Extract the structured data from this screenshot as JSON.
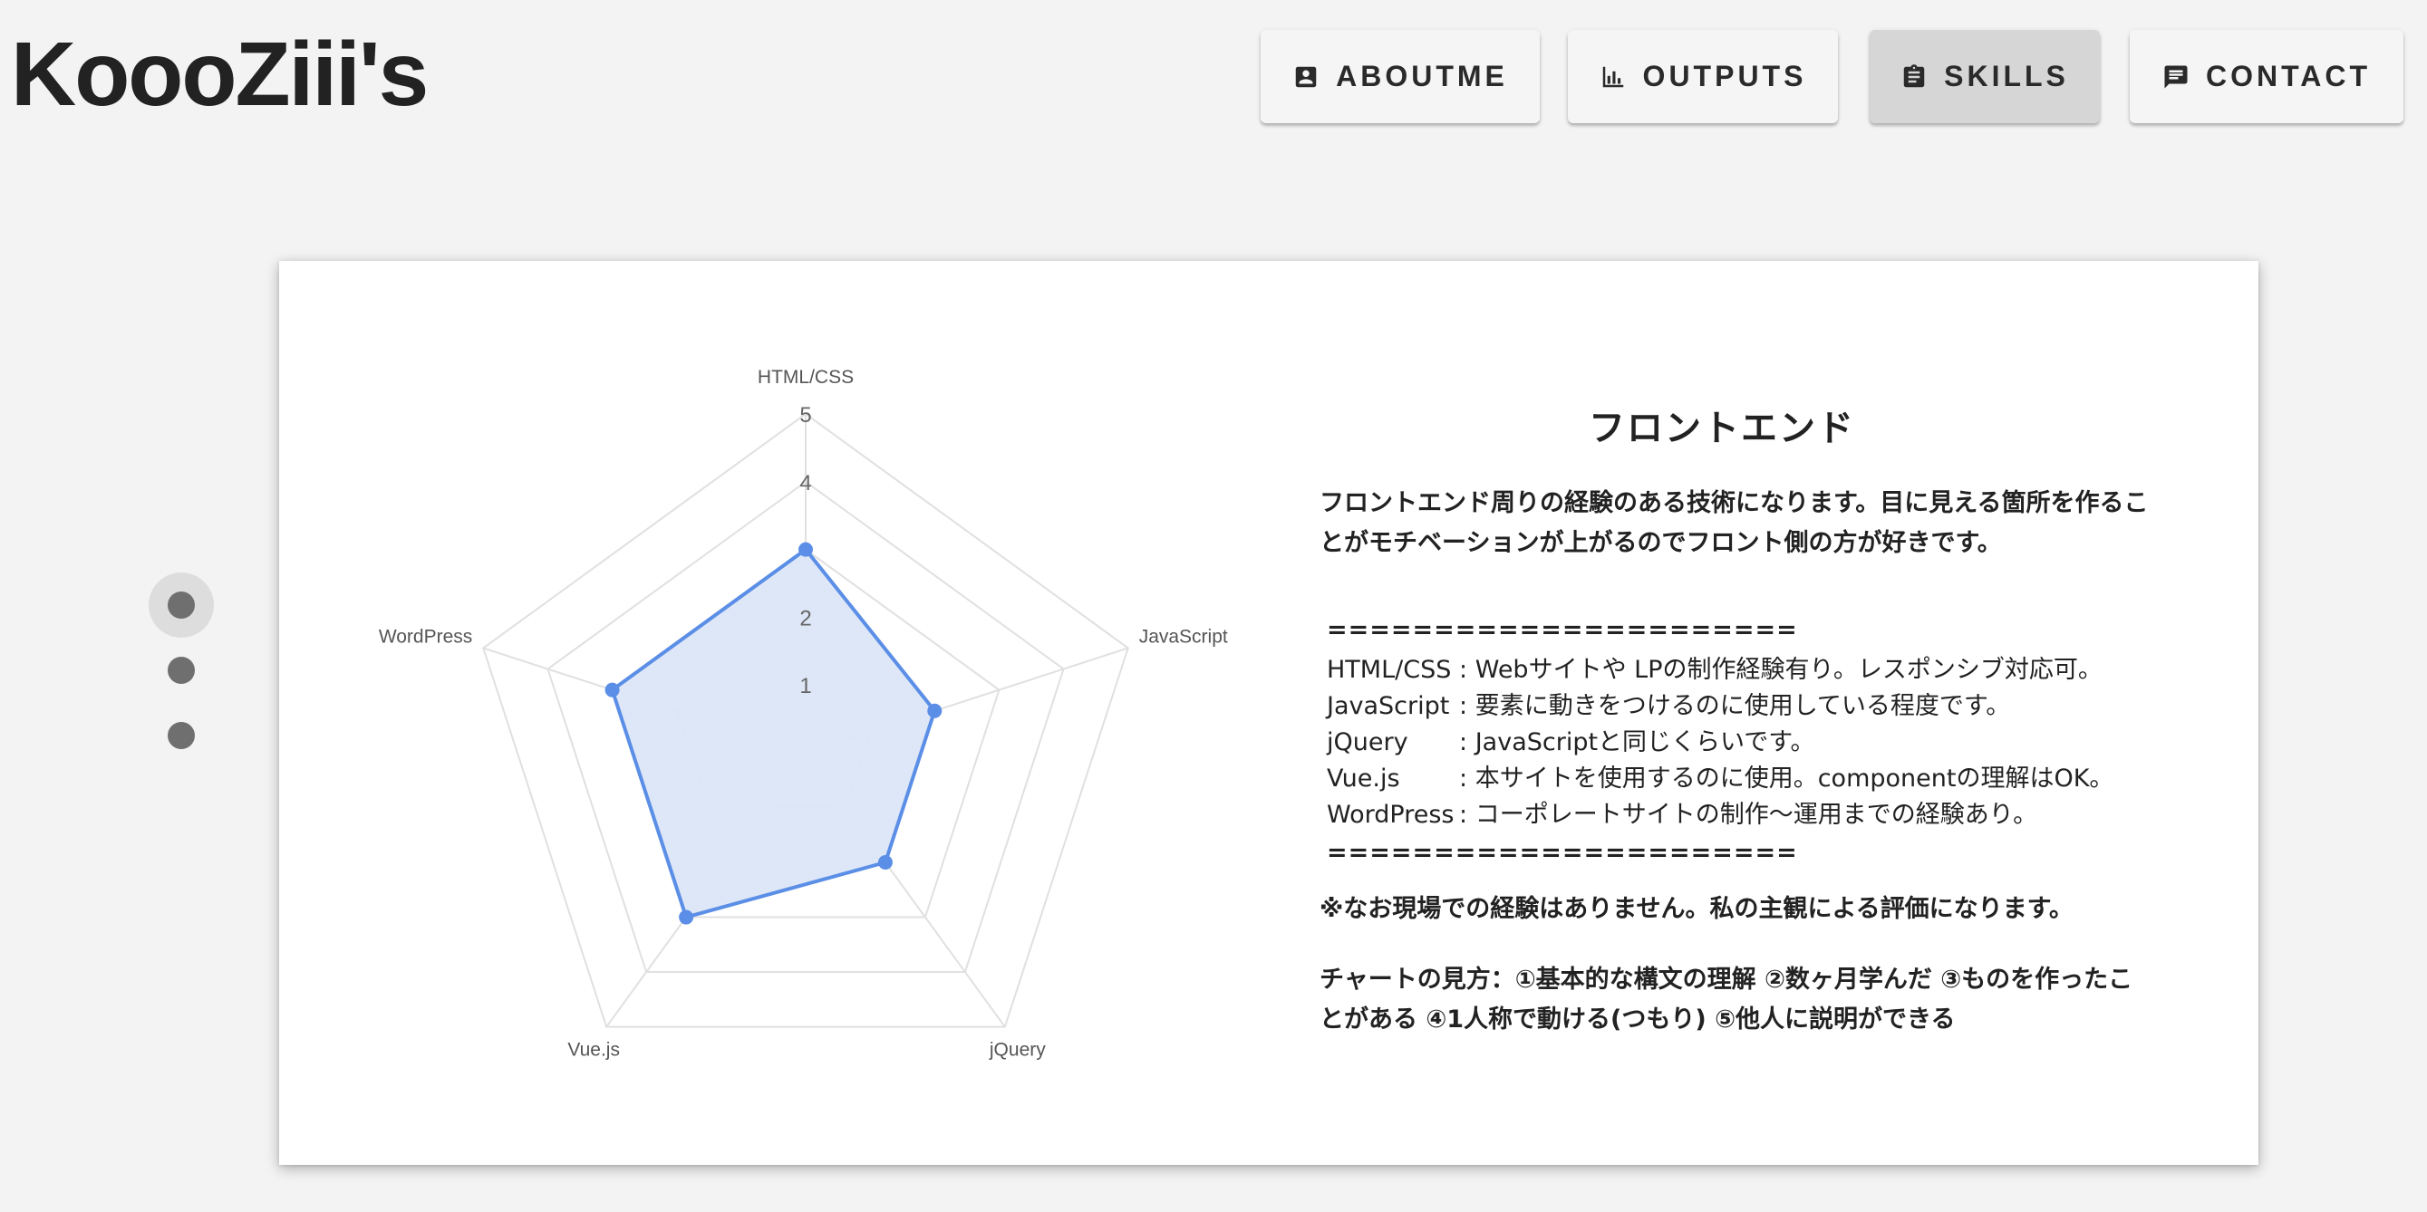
{
  "site": {
    "title": "KoooZiii's"
  },
  "nav": [
    {
      "label": "ABOUTME",
      "icon": "contact-card-icon",
      "active": false
    },
    {
      "label": "OUTPUTS",
      "icon": "bar-chart-icon",
      "active": false
    },
    {
      "label": "SKILLS",
      "icon": "clipboard-icon",
      "active": true
    },
    {
      "label": "CONTACT",
      "icon": "comment-icon",
      "active": false
    }
  ],
  "slider": {
    "dot_count": 3,
    "active_index": 0
  },
  "skills_card": {
    "title": "フロントエンド",
    "intro": "フロントエンド周りの経験のある技術になります。目に見える箇所を作ることがモチベーションが上がるのでフロント側の方が好きです。",
    "separator": "======================",
    "details": [
      {
        "name": "HTML/CSS",
        "sep": ":",
        "text": "Webサイトや LPの制作経験有り。レスポンシブ対応可。"
      },
      {
        "name": "JavaScript",
        "sep": ":",
        "text": "要素に動きをつけるのに使用している程度です。"
      },
      {
        "name": "jQuery",
        "sep": ":",
        "text": "JavaScriptと同じくらいです。"
      },
      {
        "name": "Vue.js",
        "sep": ":",
        "text": "本サイトを使用するのに使用。componentの理解はOK。"
      },
      {
        "name": "WordPress",
        "sep": ":",
        "text": "コーポレートサイトの制作〜運用までの経験あり。"
      }
    ],
    "note": "※なお現場での経験はありません。私の主観による評価になります。",
    "legend_text": "チャートの見方：①基本的な構文の理解 ②数ヶ月学んだ ③ものを作ったことがある ④1人称で動ける(つもり) ⑤他人に説明ができる"
  },
  "chart_data": {
    "type": "radar",
    "categories": [
      "HTML/CSS",
      "JavaScript",
      "jQuery",
      "Vue.js",
      "WordPress"
    ],
    "values": [
      3,
      2,
      2,
      3,
      3
    ],
    "rlim": [
      0,
      5
    ],
    "ticks": [
      "1",
      "2",
      "4",
      "5"
    ],
    "grid": true,
    "colors": {
      "line": "#5b8ee6",
      "fill": "#dbe6f7",
      "grid": "#e0e0e0"
    }
  }
}
